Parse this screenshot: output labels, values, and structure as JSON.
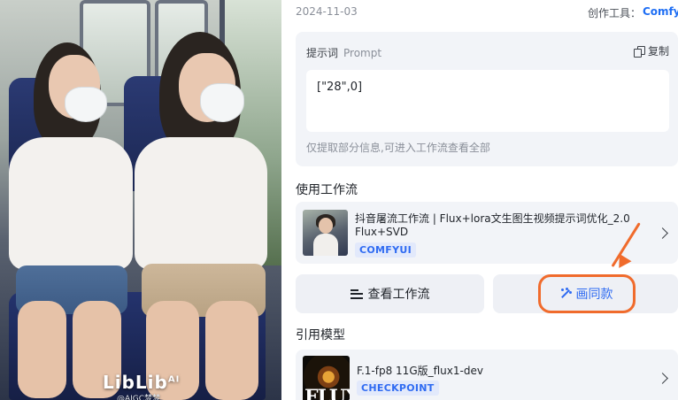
{
  "image": {
    "watermark": "LibLib",
    "watermark_sup": "AI",
    "watermark_author": "@AIGC梦梦"
  },
  "header": {
    "date": "2024-11-03",
    "tool_label": "创作工具：",
    "tool_name": "Comfy"
  },
  "prompt": {
    "title": "提示词",
    "title_en": "Prompt",
    "copy_label": "复制",
    "value": "[\"28\",0]",
    "note": "仅提取部分信息,可进入工作流查看全部"
  },
  "workflow_section": {
    "title": "使用工作流",
    "card": {
      "title": "抖音屠流工作流 | Flux+lora文生图生视频提示词优化_2.0",
      "subtitle": "Flux+SVD",
      "tag": "COMFYUI"
    }
  },
  "actions": {
    "view_workflow": "查看工作流",
    "draw_same": "画同款"
  },
  "model_section": {
    "title": "引用模型",
    "card": {
      "title": "F.1-fp8 11G版_flux1-dev",
      "tag": "CHECKPOINT",
      "thumb_text": "FLUX"
    }
  },
  "colors": {
    "accent": "#2f6bf2",
    "annotation": "#f06b2c",
    "card_bg": "#f2f4f8"
  }
}
